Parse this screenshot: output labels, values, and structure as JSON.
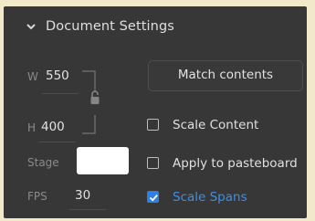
{
  "section": {
    "title": "Document Settings",
    "expanded_icon": "chevron-down-icon"
  },
  "dimensions": {
    "width_label": "W",
    "width_value": "550",
    "height_label": "H",
    "height_value": "400",
    "link_icon": "lock-icon"
  },
  "stage": {
    "label": "Stage",
    "color": "#ffffff"
  },
  "fps": {
    "label": "FPS",
    "value": "30"
  },
  "match_button": {
    "label": "Match contents"
  },
  "options": [
    {
      "label": "Scale Content",
      "checked": false
    },
    {
      "label": "Apply to pasteboard",
      "checked": false
    },
    {
      "label": "Scale Spans",
      "checked": true
    }
  ],
  "colors": {
    "panel_bg": "#373737",
    "accent": "#2f80e4",
    "page_bg": "#f1e9c9"
  }
}
